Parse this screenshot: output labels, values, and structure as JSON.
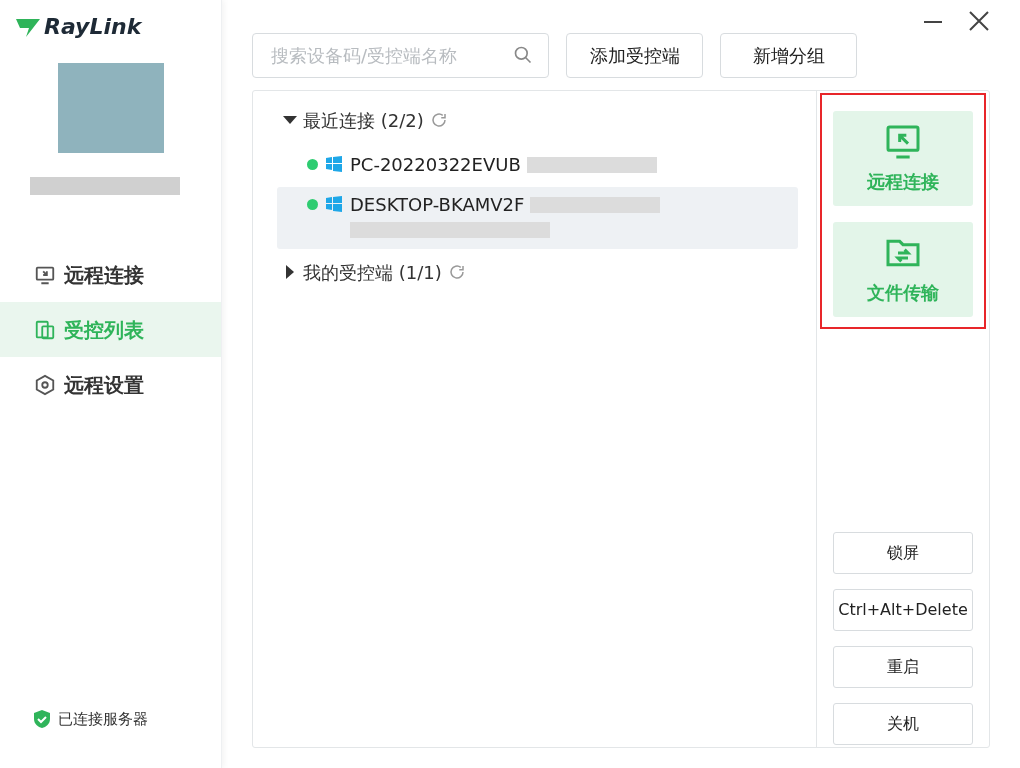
{
  "logo": {
    "text": "RayLink"
  },
  "sidebar": {
    "items": [
      {
        "label": "远程连接",
        "kind": "monitor",
        "selected": false
      },
      {
        "label": "受控列表",
        "kind": "list",
        "selected": true
      },
      {
        "label": "远程设置",
        "kind": "settings",
        "selected": false
      }
    ],
    "status": {
      "text": "已连接服务器",
      "connected": true
    }
  },
  "search": {
    "placeholder": "搜索设备码/受控端名称"
  },
  "toolbar_buttons": [
    "添加受控端",
    "新增分组"
  ],
  "groups": [
    {
      "label": "最近连接 (2/2)",
      "expanded": true,
      "devices": [
        {
          "name": "PC-20220322EVUB",
          "online": true,
          "selected": false,
          "redacted_second_line": false
        },
        {
          "name": "DESKTOP-BKAMV2F",
          "online": true,
          "selected": true,
          "redacted_second_line": true
        }
      ]
    },
    {
      "label": "我的受控端 (1/1)",
      "expanded": false
    }
  ],
  "actions": [
    {
      "label": "远程连接",
      "kind": "remote"
    },
    {
      "label": "文件传输",
      "kind": "files"
    }
  ],
  "commands": [
    "锁屏",
    "Ctrl+Alt+Delete",
    "重启",
    "关机"
  ]
}
